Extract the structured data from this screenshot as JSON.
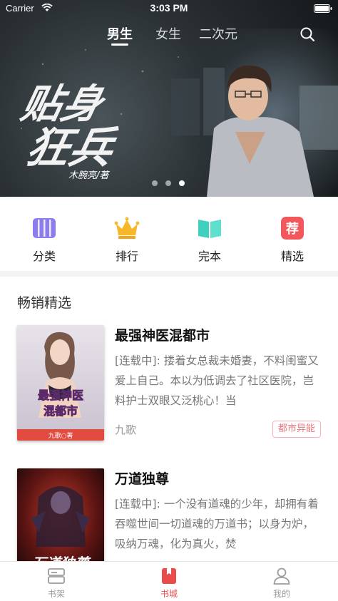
{
  "status_bar": {
    "carrier": "Carrier",
    "time": "3:03 PM"
  },
  "header": {
    "tabs": [
      {
        "label": "男生",
        "active": true
      },
      {
        "label": "女生",
        "active": false
      },
      {
        "label": "二次元",
        "active": false
      }
    ],
    "search_icon": "search-icon"
  },
  "banner": {
    "title_art": "贴身狂兵",
    "author_art": "木腕亮/著",
    "pager": {
      "count": 3,
      "active_index": 2
    }
  },
  "categories": [
    {
      "label": "分类",
      "icon": "grid-books-icon",
      "color": "#8b7cf0"
    },
    {
      "label": "排行",
      "icon": "crown-icon",
      "color": "#f7b72a"
    },
    {
      "label": "完本",
      "icon": "open-book-icon",
      "color": "#3fd1bd"
    },
    {
      "label": "精选",
      "icon": "recommend-badge-icon",
      "color": "#f2575c",
      "badge_text": "荐"
    }
  ],
  "section": {
    "title": "畅销精选"
  },
  "books": [
    {
      "title": "最强神医混都市",
      "description": "[连载中]: 搂着女总裁未婚妻，不料闺蜜又爱上自己。本以为低调去了社区医院，岂料护士双眼又泛桃心！当",
      "author": "九歌",
      "genre": "都市异能",
      "cover_text": "最强神医混都市",
      "cover_author": "九歌○著"
    },
    {
      "title": "万道独尊",
      "description": "[连载中]: 一个没有道魂的少年，却拥有着吞噬世间一切道魂的万道书；以身为炉，吸纳万魂，化为真火，焚",
      "author": "",
      "genre": "",
      "cover_text": "万道独尊"
    }
  ],
  "tabbar": {
    "items": [
      {
        "label": "书架",
        "icon": "bookshelf-icon",
        "active": false
      },
      {
        "label": "书城",
        "icon": "bookstore-icon",
        "active": true
      },
      {
        "label": "我的",
        "icon": "profile-icon",
        "active": false
      }
    ],
    "active_color": "#e94b4b",
    "inactive_color": "#9b9b9b"
  }
}
